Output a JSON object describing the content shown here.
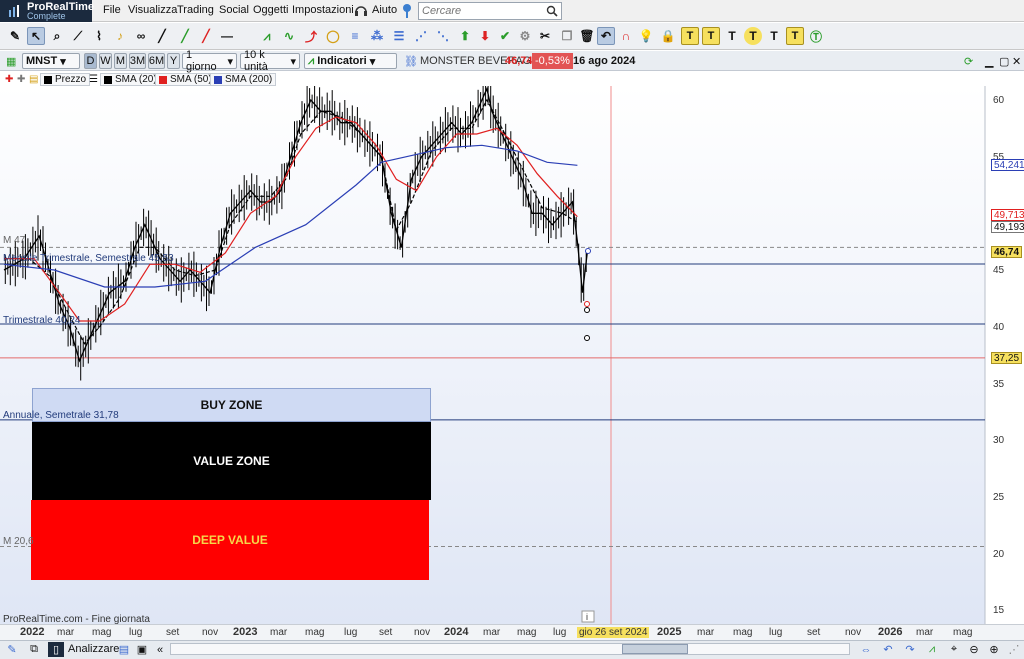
{
  "app": {
    "name": "ProRealTime",
    "edition": "Complete"
  },
  "menu": {
    "items": [
      "File",
      "Visualizza",
      "Trading",
      "Social",
      "Oggetti",
      "Impostazioni",
      "Aiuto"
    ]
  },
  "search": {
    "placeholder": "Cercare"
  },
  "toolbar": {
    "text_tools": [
      "T",
      "T",
      "T",
      "T"
    ]
  },
  "chart_header": {
    "ticker": "MNST",
    "periods": [
      "D",
      "W",
      "M",
      "3M",
      "6M",
      "Y"
    ],
    "active_period": "D",
    "timeframe": "1 giorno",
    "units": "10 k unità",
    "indicators_label": "Indicatori",
    "instrument": "MONSTER BEVERAGE",
    "last_price": "46,74",
    "change": "-0,53%",
    "date": "16 ago 2024"
  },
  "legend": {
    "items": [
      {
        "label": "Prezzo",
        "color": "#000000"
      },
      {
        "label": "SMA (20)",
        "color": "#000000"
      },
      {
        "label": "SMA (50)",
        "color": "#e02020"
      },
      {
        "label": "SMA (200)",
        "color": "#2b3fb5"
      }
    ]
  },
  "levels": {
    "m47": "M 47",
    "mensile": "Mensile Trimestrale, Semestrale 45,53",
    "trimestrale": "Trimestrale 40,24",
    "annuale": "Annuale, Semetrale 31,78",
    "m20": "M 20,6"
  },
  "zones": {
    "buy": "BUY ZONE",
    "value": "VALUE ZONE",
    "deep": "DEEP VALUE"
  },
  "price_axis": {
    "labels": [
      "60",
      "55",
      "50",
      "45",
      "40",
      "35",
      "30",
      "25",
      "20",
      "15"
    ],
    "tags": {
      "sma200": "54,241",
      "sma50": "49,713",
      "sma20": "49,193",
      "last": "46,74",
      "level": "37,25"
    }
  },
  "x_axis": {
    "labels": [
      {
        "t": "2022",
        "b": true
      },
      {
        "t": "mar"
      },
      {
        "t": "mag"
      },
      {
        "t": "lug"
      },
      {
        "t": "set"
      },
      {
        "t": "nov"
      },
      {
        "t": "2023",
        "b": true
      },
      {
        "t": "mar"
      },
      {
        "t": "mag"
      },
      {
        "t": "lug"
      },
      {
        "t": "set"
      },
      {
        "t": "nov"
      },
      {
        "t": "2024",
        "b": true
      },
      {
        "t": "mar"
      },
      {
        "t": "mag"
      },
      {
        "t": "lug"
      },
      {
        "t": "2025",
        "b": true
      },
      {
        "t": "mar"
      },
      {
        "t": "mag"
      },
      {
        "t": "lug"
      },
      {
        "t": "set"
      },
      {
        "t": "nov"
      },
      {
        "t": "2026",
        "b": true
      },
      {
        "t": "mar"
      },
      {
        "t": "mag"
      }
    ],
    "cursor_date": "gio 26 set 2024"
  },
  "footer": {
    "source": "ProRealTime.com - Fine giornata",
    "analyzer": "Analizzare"
  },
  "chart_data": {
    "type": "line",
    "yrange": [
      14,
      62
    ],
    "series": [
      {
        "name": "Prezzo",
        "color": "#000000",
        "values": [
          [
            0,
            45
          ],
          [
            4,
            46
          ],
          [
            7,
            48
          ],
          [
            9,
            45
          ],
          [
            11,
            42
          ],
          [
            13,
            40
          ],
          [
            15,
            37
          ],
          [
            16,
            38
          ],
          [
            18,
            40
          ],
          [
            21,
            43
          ],
          [
            24,
            44
          ],
          [
            26,
            47
          ],
          [
            28,
            49
          ],
          [
            29,
            48
          ],
          [
            31,
            46
          ],
          [
            33,
            45
          ],
          [
            35,
            44
          ],
          [
            37,
            45
          ],
          [
            39,
            44
          ],
          [
            41,
            43
          ],
          [
            43,
            47
          ],
          [
            45,
            50
          ],
          [
            47,
            51
          ],
          [
            49,
            52
          ],
          [
            51,
            51
          ],
          [
            53,
            51
          ],
          [
            55,
            52
          ],
          [
            57,
            55
          ],
          [
            59,
            58
          ],
          [
            61,
            60
          ],
          [
            63,
            59
          ],
          [
            65,
            59
          ],
          [
            67,
            58
          ],
          [
            69,
            58
          ],
          [
            71,
            57
          ],
          [
            73,
            56
          ],
          [
            75,
            55
          ],
          [
            77,
            50
          ],
          [
            79,
            47
          ],
          [
            81,
            53
          ],
          [
            83,
            55
          ],
          [
            85,
            56
          ],
          [
            87,
            57
          ],
          [
            89,
            58
          ],
          [
            91,
            57
          ],
          [
            93,
            58
          ],
          [
            95,
            60
          ],
          [
            96,
            61
          ],
          [
            97,
            59
          ],
          [
            99,
            57
          ],
          [
            101,
            55
          ],
          [
            103,
            53
          ],
          [
            105,
            50
          ],
          [
            107,
            50
          ],
          [
            109,
            49
          ],
          [
            111,
            50
          ],
          [
            113,
            51
          ],
          [
            114,
            47.5
          ],
          [
            115,
            43
          ],
          [
            116,
            46.7
          ]
        ]
      },
      {
        "name": "SMA (20)",
        "color": "#000000",
        "values": [
          [
            0,
            46
          ],
          [
            5,
            46
          ],
          [
            9,
            44.5
          ],
          [
            13,
            41
          ],
          [
            16,
            38.5
          ],
          [
            19,
            40
          ],
          [
            23,
            42.5
          ],
          [
            27,
            47
          ],
          [
            30,
            47
          ],
          [
            34,
            45
          ],
          [
            38,
            44.5
          ],
          [
            42,
            45
          ],
          [
            45,
            49
          ],
          [
            49,
            51.5
          ],
          [
            53,
            51.5
          ],
          [
            56,
            53
          ],
          [
            59,
            57
          ],
          [
            63,
            59
          ],
          [
            67,
            58.5
          ],
          [
            71,
            57
          ],
          [
            75,
            55
          ],
          [
            78,
            48.5
          ],
          [
            81,
            51
          ],
          [
            85,
            55.5
          ],
          [
            89,
            57.5
          ],
          [
            93,
            57.5
          ],
          [
            96,
            60
          ],
          [
            99,
            57.5
          ],
          [
            103,
            54
          ],
          [
            107,
            50.5
          ],
          [
            111,
            50
          ],
          [
            114,
            49.2
          ]
        ]
      },
      {
        "name": "SMA (50)",
        "color": "#e02020",
        "values": [
          [
            0,
            46
          ],
          [
            6,
            46
          ],
          [
            11,
            43
          ],
          [
            15,
            40.5
          ],
          [
            19,
            40.5
          ],
          [
            24,
            42
          ],
          [
            29,
            45.5
          ],
          [
            34,
            45.5
          ],
          [
            39,
            44.8
          ],
          [
            44,
            46.5
          ],
          [
            49,
            50
          ],
          [
            54,
            51.5
          ],
          [
            58,
            55
          ],
          [
            62,
            57.5
          ],
          [
            66,
            58.5
          ],
          [
            70,
            58
          ],
          [
            74,
            56
          ],
          [
            78,
            53
          ],
          [
            82,
            52
          ],
          [
            86,
            55
          ],
          [
            90,
            57
          ],
          [
            94,
            57
          ],
          [
            98,
            57.5
          ],
          [
            102,
            56
          ],
          [
            106,
            53.5
          ],
          [
            110,
            51.5
          ],
          [
            114,
            49.7
          ]
        ]
      },
      {
        "name": "SMA (200)",
        "color": "#2b3fb5",
        "values": [
          [
            0,
            45.5
          ],
          [
            10,
            45
          ],
          [
            20,
            43.5
          ],
          [
            30,
            43.5
          ],
          [
            40,
            44
          ],
          [
            50,
            47
          ],
          [
            60,
            49
          ],
          [
            70,
            52.5
          ],
          [
            75,
            54.5
          ],
          [
            80,
            55
          ],
          [
            88,
            55.8
          ],
          [
            95,
            56
          ],
          [
            102,
            55.5
          ],
          [
            108,
            54.5
          ],
          [
            114,
            54.24
          ]
        ]
      }
    ],
    "horizontal_lines": [
      {
        "value": 47,
        "style": "dashed",
        "color": "#888888"
      },
      {
        "value": 45.53,
        "style": "solid",
        "color": "#223b7b"
      },
      {
        "value": 40.24,
        "style": "solid",
        "color": "#223b7b"
      },
      {
        "value": 37.25,
        "style": "solid",
        "color": "#e46a6a"
      },
      {
        "value": 31.78,
        "style": "solid",
        "color": "#223b7b"
      },
      {
        "value": 20.6,
        "style": "dashed",
        "color": "#888888"
      }
    ]
  }
}
